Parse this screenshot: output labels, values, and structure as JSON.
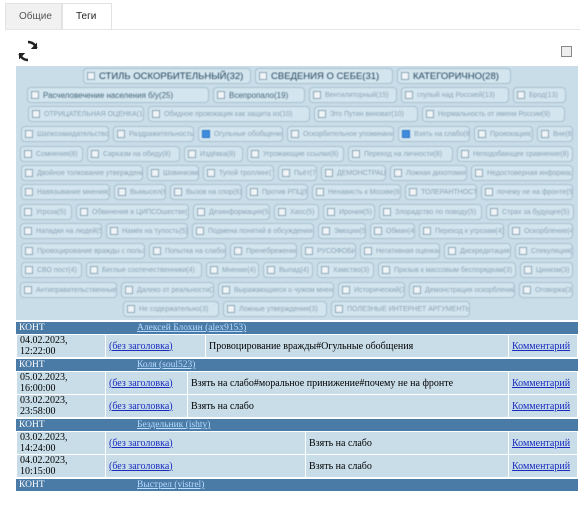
{
  "tabs": [
    {
      "label": "Общие"
    },
    {
      "label": "Теги"
    }
  ],
  "tag_rows": [
    [
      {
        "label": "СТИЛЬ ОСКОРБИТЕЛЬНЫЙ(32)",
        "size": "big"
      },
      {
        "label": "СВЕДЕНИЯ О СЕБЕ(31)",
        "size": "big"
      },
      {
        "label": "КАТЕГОРИЧНО(28)",
        "size": "big"
      }
    ],
    [
      {
        "label": "Расчеловечение населения б/у(25)",
        "size": "mid"
      },
      {
        "label": "Всепропало(19)",
        "size": "mid"
      },
      {
        "label": "Вентиляторный(15)"
      },
      {
        "label": "глупый над Россией(13)"
      },
      {
        "label": "Брод(13)"
      }
    ],
    [
      {
        "label": "ОТРИЦАТЕЛЬНАЯ ОЦЕНКА(11)"
      },
      {
        "label": "Обидное провокация как защита из(10)"
      },
      {
        "label": "Это Путин виноват(10)"
      },
      {
        "label": "Нормальность от имени России(9)"
      }
    ],
    [
      {
        "label": "Шапкозакидательство(9)"
      },
      {
        "label": "Раздражительность(9)"
      },
      {
        "label": "Огульные обобщения(9)",
        "checked": true
      },
      {
        "label": "Оскорбительное упоминание(9)"
      },
      {
        "label": "Взять на слабо(8)",
        "checked": true
      },
      {
        "label": "Провокация(8)"
      },
      {
        "label": "Вне(8)"
      }
    ],
    [
      {
        "label": "Сомнения(8)"
      },
      {
        "label": "Сарказм на обиду(8)"
      },
      {
        "label": "Издёвка(8)"
      },
      {
        "label": "Угрожающие ссылки(8)"
      },
      {
        "label": "Переход на личности(8)"
      },
      {
        "label": "Неподобающее сравнение(8)"
      }
    ],
    [
      {
        "label": "Двойное толкование утверждения(8)"
      },
      {
        "label": "Шовинизм(7)"
      },
      {
        "label": "Тупой троллинг(7)"
      },
      {
        "label": "Пьёт(7)"
      },
      {
        "label": "ДЕМОНСТРАЦИЯ(7)"
      },
      {
        "label": "Ложная дихотомия(6)"
      },
      {
        "label": "Недостоверная информация(6)"
      }
    ],
    [
      {
        "label": "Навязывание мнения(6)"
      },
      {
        "label": "Вымысел(6)"
      },
      {
        "label": "Вызов на спор(6)"
      },
      {
        "label": "Против РПЦ(6)"
      },
      {
        "label": "Ненависть к Москве(6)"
      },
      {
        "label": "ТОЛЕРАНТНОСТЬ(5)"
      },
      {
        "label": "почему не на фронте(5)"
      }
    ],
    [
      {
        "label": "Угроза(5)"
      },
      {
        "label": "Обвинения в ЦИПСОшестве(5)"
      },
      {
        "label": "Дезинформация(5)"
      },
      {
        "label": "Хаос(5)"
      },
      {
        "label": "Ирония(5)"
      },
      {
        "label": "Злорадство по поводу(5)"
      },
      {
        "label": "Страх за будущее(5)"
      }
    ],
    [
      {
        "label": "Нападки на людей(5)"
      },
      {
        "label": "Намёк на тупость(5)"
      },
      {
        "label": "Подмена понятий в обсуждении(5)"
      },
      {
        "label": "Эмоции(5)"
      },
      {
        "label": "Обман(4)"
      },
      {
        "label": "Переход к угрозам(4)"
      },
      {
        "label": "Оскорбление(4)"
      }
    ],
    [
      {
        "label": "Провоцирование вражды с пользой(4)"
      },
      {
        "label": "Попытка на слабо(4)"
      },
      {
        "label": "Пренебрежение(4)"
      },
      {
        "label": "РУСОФОБИЯ(4)"
      },
      {
        "label": "Негативная оценка(4)"
      },
      {
        "label": "Дискредитация(4)"
      },
      {
        "label": "Спекуляция(4)"
      }
    ],
    [
      {
        "label": "СВО пост(4)"
      },
      {
        "label": "Беглые соотечественники(4)"
      },
      {
        "label": "Мнение(4)"
      },
      {
        "label": "Выпад(4)"
      },
      {
        "label": "Хамство(3)"
      },
      {
        "label": "Призыв к массовым беспорядкам(3)"
      },
      {
        "label": "Цинизм(3)"
      }
    ],
    [
      {
        "label": "Антиправительственные(3)"
      },
      {
        "label": "Далеко от реальности(3)"
      },
      {
        "label": "Выражающиеся о чужом мнении(3)"
      },
      {
        "label": "Исторический(3)"
      },
      {
        "label": "Демонстрация оскорблений(3)"
      },
      {
        "label": "Оговорка(3)"
      }
    ],
    [
      {
        "label": "Не содержательно(3)"
      },
      {
        "label": "Ложные утверждения(3)"
      },
      {
        "label": "ПОЛЕЗНЫЕ ИНТЕРНЕТ АРГУМЕНТЫ(3)"
      }
    ]
  ],
  "feed": {
    "group_label": "КОНТ",
    "groups": [
      {
        "user": "Алексей Блохин (alex9153)",
        "rows": [
          {
            "date": "04.02.2023,",
            "time": "12:22:00",
            "title": "(без заголовка)",
            "tags": "Провоцирование вражды#Огульные обобщения",
            "comment": "Комментарий"
          }
        ]
      },
      {
        "user": "Коля (soul523)",
        "rows": [
          {
            "date": "05.02.2023,",
            "time": "16:00:00",
            "title": "(без заголовка)",
            "tags": "Взять на слабо#моральное принижение#почему не на фронте",
            "comment": "Комментарий"
          },
          {
            "date": "03.02.2023,",
            "time": "23:58:00",
            "title": "(без заголовка)",
            "tags": "Взять на слабо",
            "comment": "Комментарий"
          }
        ]
      },
      {
        "user": "Бездельник (ishty)",
        "rows": [
          {
            "date": "03.02.2023,",
            "time": "14:24:00",
            "title": "(без заголовка)",
            "tags": "Взять на слабо",
            "comment": "Комментарий"
          },
          {
            "date": "04.02.2023,",
            "time": "10:15:00",
            "title": "(без заголовка)",
            "tags": "Взять на слабо",
            "comment": "Комментарий"
          }
        ]
      },
      {
        "user": "Выстрел (vistrel)",
        "rows": []
      }
    ]
  },
  "icons": {
    "refresh": "refresh-icon"
  },
  "colors": {
    "panel": "#c8dde8",
    "group_header": "#4a7aa6",
    "link": "#1a2bbf"
  }
}
